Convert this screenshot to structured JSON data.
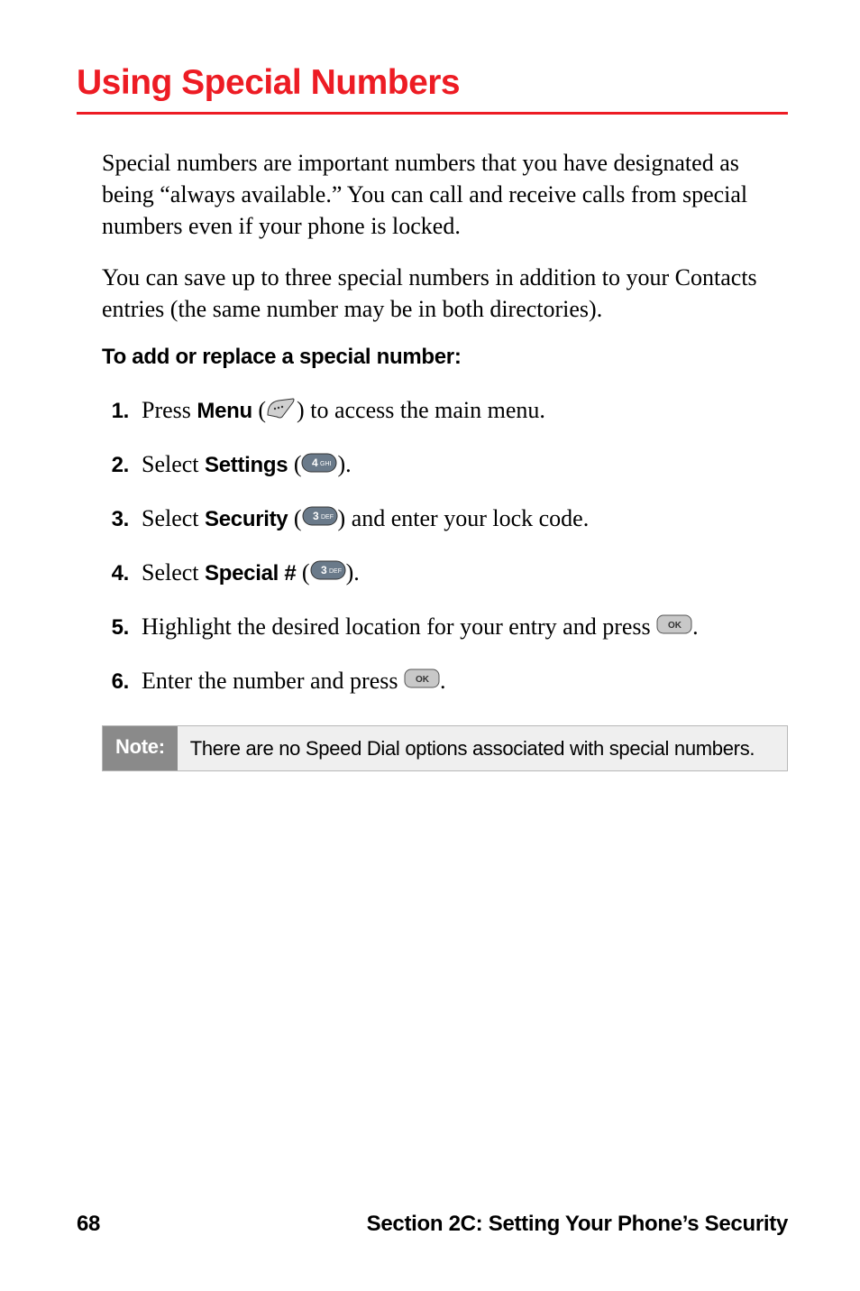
{
  "heading": "Using Special Numbers",
  "para1": "Special numbers are important numbers that you have designated as being “always available.” You can call and receive calls from special numbers even if your phone is locked.",
  "para2": "You can save up to three special numbers in addition to your Contacts entries (the same number may be in both directories).",
  "subhead": "To add or replace a special number:",
  "steps": {
    "s1": {
      "num": "1.",
      "pre": "Press ",
      "bold": "Menu",
      "post": " to access the main menu."
    },
    "s2": {
      "num": "2.",
      "pre": "Select ",
      "bold": "Settings",
      "post": "."
    },
    "s3": {
      "num": "3.",
      "pre": "Select ",
      "bold": "Security",
      "post": " and enter your lock code."
    },
    "s4": {
      "num": "4.",
      "pre": "Select ",
      "bold": "Special #",
      "post": "."
    },
    "s5": {
      "num": "5.",
      "text_a": "Highlight the desired location for your entry and press ",
      "text_b": "."
    },
    "s6": {
      "num": "6.",
      "text_a": "Enter the number and press ",
      "text_b": "."
    }
  },
  "note": {
    "label": "Note:",
    "text": "There are no Speed Dial options associated with special numbers."
  },
  "footer": {
    "page": "68",
    "section": "Section 2C: Setting Your Phone’s Security"
  }
}
